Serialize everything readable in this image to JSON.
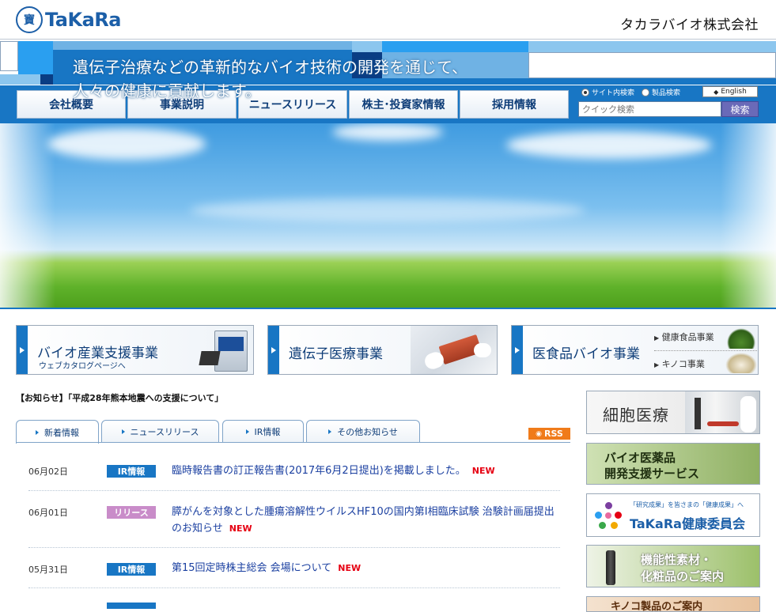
{
  "header": {
    "logo_mark": "寶",
    "logo_text": "TaKaRa",
    "company": "タカラバイオ株式会社"
  },
  "nav": {
    "items": [
      "会社概要",
      "事業説明",
      "ニュースリリース",
      "株主･投資家情報",
      "採用情報"
    ]
  },
  "search": {
    "opt_site": "サイト内検索",
    "opt_product": "製品検索",
    "english": "English",
    "placeholder": "クイック検索",
    "button": "検索"
  },
  "hero": {
    "line1": "遺伝子治療などの革新的なバイオ技術の開発を通じて、",
    "line2": "人々の健康に貢献します。"
  },
  "biz": {
    "b1_title": "バイオ産業支援事業",
    "b1_sub": "ウェブカタログページへ",
    "b2_title": "遺伝子医療事業",
    "b3_title": "医食品バイオ事業",
    "b3_link1": "健康食品事業",
    "b3_link2": "キノコ事業"
  },
  "notice": "【お知らせ】「平成28年熊本地震への支援について」",
  "tabs": [
    "新着情報",
    "ニュースリリース",
    "IR情報",
    "その他お知らせ"
  ],
  "rss": "RSS",
  "news": [
    {
      "date": "06月02日",
      "cat": "IR情報",
      "cat_color": "#1876c4",
      "text": "臨時報告書の訂正報告書(2017年6月2日提出)を掲載しました。",
      "new": "NEW"
    },
    {
      "date": "06月01日",
      "cat": "リリース",
      "cat_color": "#c98cc9",
      "text": "膵がんを対象とした腫瘍溶解性ウイルスHF10の国内第I相臨床試験 治験計画届提出のお知らせ",
      "new": "NEW"
    },
    {
      "date": "05月31日",
      "cat": "IR情報",
      "cat_color": "#1876c4",
      "text": "第15回定時株主総会 会場について",
      "new": "NEW"
    }
  ],
  "side": {
    "s1": "細胞医療",
    "s2_l1": "バイオ医薬品",
    "s2_l2": "開発支援サービス",
    "s3_top": "「研究成果」を皆さまの「健康成果」へ",
    "s3_main": "TaKaRa健康委員会",
    "s4_l1": "機能性素材・",
    "s4_l2": "化粧品のご案内",
    "s5": "キノコ製品のご案内"
  },
  "colors": {
    "primary": "#1876c4",
    "navy": "#0e3d78",
    "new": "#e60012"
  }
}
